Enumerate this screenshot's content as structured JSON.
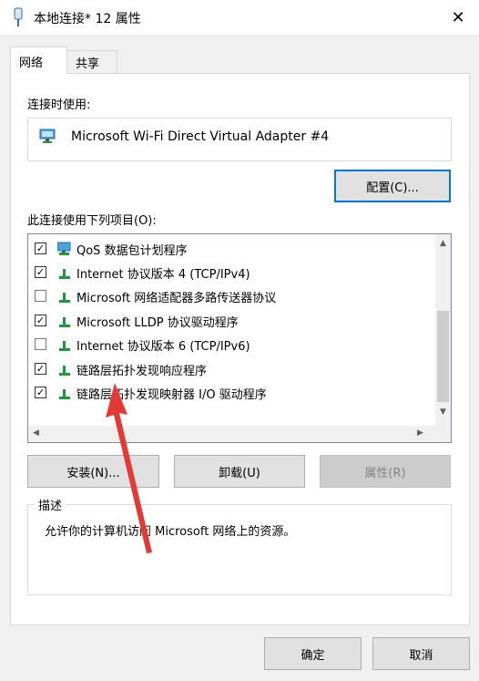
{
  "window": {
    "title": "本地连接* 12 属性",
    "close_glyph": "✕"
  },
  "tabs": [
    {
      "label": "网络",
      "active": true
    },
    {
      "label": "共享",
      "active": false
    }
  ],
  "connect_using": {
    "label": "连接时使用:",
    "adapter": "Microsoft Wi-Fi Direct Virtual Adapter #4",
    "adapter_icon": "network-adapter-icon"
  },
  "buttons": {
    "configure": "配置(C)...",
    "install": "安装(N)...",
    "uninstall": "卸载(U)",
    "properties": "属性(R)",
    "ok": "确定",
    "cancel": "取消"
  },
  "items_label": "此连接使用下列项目(O):",
  "items": [
    {
      "checked": true,
      "icon": "qos-scheduler-icon",
      "label": "QoS 数据包计划程序"
    },
    {
      "checked": true,
      "icon": "protocol-icon",
      "label": "Internet 协议版本 4 (TCP/IPv4)"
    },
    {
      "checked": false,
      "icon": "protocol-icon",
      "label": "Microsoft 网络适配器多路传送器协议"
    },
    {
      "checked": true,
      "icon": "protocol-icon",
      "label": "Microsoft LLDP 协议驱动程序"
    },
    {
      "checked": false,
      "icon": "protocol-icon",
      "label": "Internet 协议版本 6 (TCP/IPv6)"
    },
    {
      "checked": true,
      "icon": "protocol-icon",
      "label": "链路层拓扑发现响应程序"
    },
    {
      "checked": true,
      "icon": "protocol-icon",
      "label": "链路层拓扑发现映射器 I/O 驱动程序"
    }
  ],
  "description": {
    "title": "描述",
    "text": "允许你的计算机访问 Microsoft 网络上的资源。"
  },
  "colors": {
    "accent": "#0078d7",
    "annotation_arrow": "#e53935",
    "protocol_icon": "#1a9b3a"
  }
}
